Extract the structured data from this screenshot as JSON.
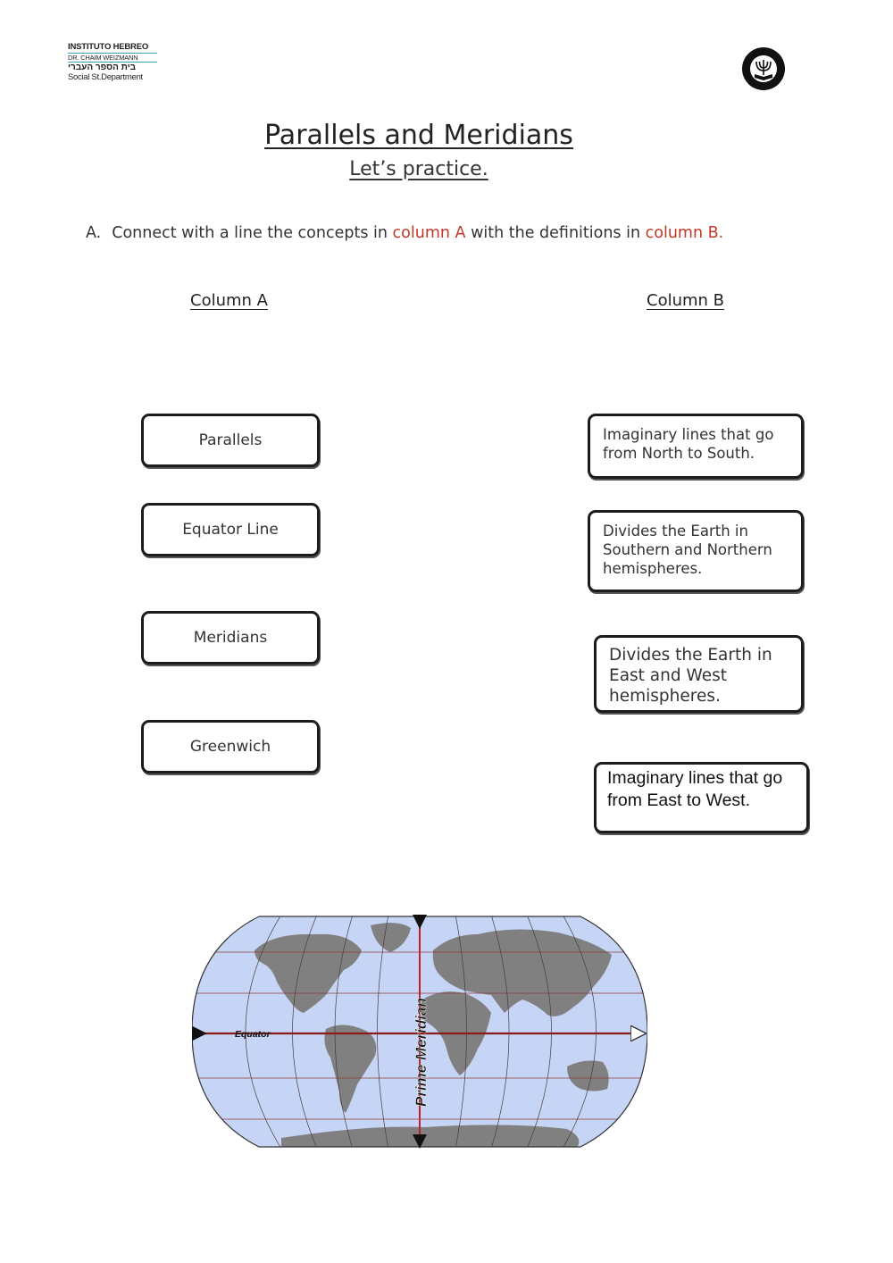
{
  "header": {
    "school_logo": {
      "line1": "INSTITUTO HEBREO",
      "line2": "DR. CHAIM WEIZMANN",
      "line3": "בית הספר העברי",
      "line4": "Social St.Department"
    },
    "seal_icon": "school-seal-menorah-icon"
  },
  "title": "Parallels and Meridians",
  "subtitle": "Let’s practice.",
  "instruction": {
    "marker": "A.",
    "text_1": "Connect with a line the concepts in ",
    "highlight_1": "column A",
    "text_2": " with the definitions in ",
    "highlight_2": "column B.",
    "highlight_color": "#c0392b"
  },
  "column_a": {
    "header": "Column A",
    "items": [
      "Parallels",
      "Equator Line",
      "Meridians",
      "Greenwich"
    ]
  },
  "column_b": {
    "header": "Column B",
    "items": [
      "Imaginary lines that go from North to South.",
      "Divides the Earth in Southern and Northern hemispheres.",
      "Divides the Earth in East and West hemispheres.",
      "Imaginary lines that go from East to West."
    ]
  },
  "map": {
    "equator_label": "Equator",
    "prime_meridian_label": "Prime Meridian",
    "ocean_color": "#c6d5f5",
    "land_color": "#808080",
    "line_color": "#8b1a1a"
  }
}
